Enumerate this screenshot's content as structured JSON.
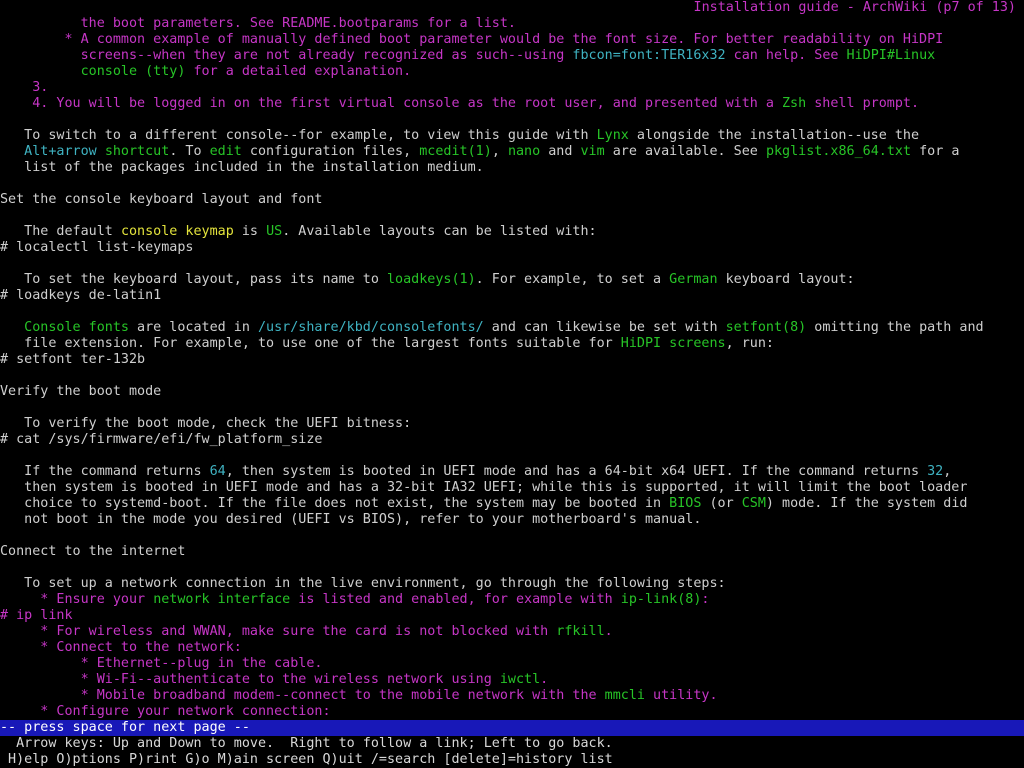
{
  "header": {
    "left": "#",
    "title": "Installation guide - ArchWiki (p7 of 13)"
  },
  "lines": [
    [
      [
        "m",
        "          the boot parameters. See README.bootparams for a list."
      ]
    ],
    [
      [
        "m",
        "        * A common example of manually defined boot parameter would be the font size. For better readability on HiDPI"
      ]
    ],
    [
      [
        "m",
        "          screens--when they are not already recognized as such--using "
      ],
      [
        "c",
        "fbcon=font:TER16x32"
      ],
      [
        "m",
        " can help. See "
      ],
      [
        "g",
        "HiDPI#Linux"
      ]
    ],
    [
      [
        "g",
        "          console (tty)"
      ],
      [
        "m",
        " for a detailed explanation."
      ]
    ],
    [
      [
        "m",
        "    3."
      ]
    ],
    [
      [
        "m",
        "    4. You will be logged in on the first virtual console as the root user, and presented with a "
      ],
      [
        "g",
        "Zsh"
      ],
      [
        "m",
        " shell prompt."
      ]
    ],
    [
      [
        "w",
        ""
      ]
    ],
    [
      [
        "w",
        "   To switch to a different console--for example, to view this guide with "
      ],
      [
        "g",
        "Lynx"
      ],
      [
        "w",
        " alongside the installation--use the"
      ]
    ],
    [
      [
        "c",
        "   Alt+arrow"
      ],
      [
        "w",
        " "
      ],
      [
        "g",
        "shortcut"
      ],
      [
        "w",
        ". To "
      ],
      [
        "g",
        "edit"
      ],
      [
        "w",
        " configuration files, "
      ],
      [
        "g",
        "mcedit(1)"
      ],
      [
        "w",
        ", "
      ],
      [
        "g",
        "nano"
      ],
      [
        "w",
        " and "
      ],
      [
        "g",
        "vim"
      ],
      [
        "w",
        " are available. See "
      ],
      [
        "g",
        "pkglist.x86_64.txt"
      ],
      [
        "w",
        " for a"
      ]
    ],
    [
      [
        "w",
        "   list of the packages included in the installation medium."
      ]
    ],
    [
      [
        "w",
        ""
      ]
    ],
    [
      [
        "w",
        "Set the console keyboard layout and font"
      ]
    ],
    [
      [
        "w",
        ""
      ]
    ],
    [
      [
        "w",
        "   The default "
      ],
      [
        "y",
        "console keymap"
      ],
      [
        "w",
        " is "
      ],
      [
        "g",
        "US"
      ],
      [
        "w",
        ". Available layouts can be listed with:"
      ]
    ],
    [
      [
        "w",
        "# localectl list-keymaps"
      ]
    ],
    [
      [
        "w",
        ""
      ]
    ],
    [
      [
        "w",
        "   To set the keyboard layout, pass its name to "
      ],
      [
        "g",
        "loadkeys(1)"
      ],
      [
        "w",
        ". For example, to set a "
      ],
      [
        "g",
        "German"
      ],
      [
        "w",
        " keyboard layout:"
      ]
    ],
    [
      [
        "w",
        "# loadkeys de-latin1"
      ]
    ],
    [
      [
        "w",
        ""
      ]
    ],
    [
      [
        "g",
        "   Console fonts"
      ],
      [
        "w",
        " are located in "
      ],
      [
        "c",
        "/usr/share/kbd/consolefonts/"
      ],
      [
        "w",
        " and can likewise be set with "
      ],
      [
        "g",
        "setfont(8)"
      ],
      [
        "w",
        " omitting the path and"
      ]
    ],
    [
      [
        "w",
        "   file extension. For example, to use one of the largest fonts suitable for "
      ],
      [
        "g",
        "HiDPI screens"
      ],
      [
        "w",
        ", run:"
      ]
    ],
    [
      [
        "w",
        "# setfont ter-132b"
      ]
    ],
    [
      [
        "w",
        ""
      ]
    ],
    [
      [
        "w",
        "Verify the boot mode"
      ]
    ],
    [
      [
        "w",
        ""
      ]
    ],
    [
      [
        "w",
        "   To verify the boot mode, check the UEFI bitness:"
      ]
    ],
    [
      [
        "w",
        "# cat /sys/firmware/efi/fw_platform_size"
      ]
    ],
    [
      [
        "w",
        ""
      ]
    ],
    [
      [
        "w",
        "   If the command returns "
      ],
      [
        "c",
        "64"
      ],
      [
        "w",
        ", then system is booted in UEFI mode and has a 64-bit x64 UEFI. If the command returns "
      ],
      [
        "c",
        "32"
      ],
      [
        "w",
        ","
      ]
    ],
    [
      [
        "w",
        "   then system is booted in UEFI mode and has a 32-bit IA32 UEFI; while this is supported, it will limit the boot loader"
      ]
    ],
    [
      [
        "w",
        "   choice to systemd-boot. If the file does not exist, the system may be booted in "
      ],
      [
        "g",
        "BIOS"
      ],
      [
        "w",
        " (or "
      ],
      [
        "g",
        "CSM"
      ],
      [
        "w",
        ") mode. If the system did"
      ]
    ],
    [
      [
        "w",
        "   not boot in the mode you desired (UEFI vs BIOS), refer to your motherboard's manual."
      ]
    ],
    [
      [
        "w",
        ""
      ]
    ],
    [
      [
        "w",
        "Connect to the internet"
      ]
    ],
    [
      [
        "w",
        ""
      ]
    ],
    [
      [
        "w",
        "   To set up a network connection in the live environment, go through the following steps:"
      ]
    ],
    [
      [
        "m",
        "     * Ensure your "
      ],
      [
        "g",
        "network interface"
      ],
      [
        "m",
        " is listed and enabled, for example with "
      ],
      [
        "g",
        "ip-link(8)"
      ],
      [
        "m",
        ":"
      ]
    ],
    [
      [
        "m",
        "# ip link"
      ]
    ],
    [
      [
        "m",
        "     * For wireless and WWAN, make sure the card is not blocked with "
      ],
      [
        "g",
        "rfkill"
      ],
      [
        "m",
        "."
      ]
    ],
    [
      [
        "m",
        "     * Connect to the network:"
      ]
    ],
    [
      [
        "m",
        "          * Ethernet--plug in the cable."
      ]
    ],
    [
      [
        "m",
        "          * Wi-Fi--authenticate to the wireless network using "
      ],
      [
        "g",
        "iwctl"
      ],
      [
        "m",
        "."
      ]
    ],
    [
      [
        "m",
        "          * Mobile broadband modem--connect to the mobile network with the "
      ],
      [
        "g",
        "mmcli"
      ],
      [
        "m",
        " utility."
      ]
    ],
    [
      [
        "m",
        "     * Configure your network connection:"
      ]
    ]
  ],
  "status_bar": {
    "text": "-- press space for next page --"
  },
  "help": {
    "line1": "  Arrow keys: Up and Down to move.  Right to follow a link; Left to go back.",
    "line2": " H)elp O)ptions P)rint G)o M)ain screen Q)uit /=search [delete]=history list"
  },
  "colors": {
    "background": "#000000",
    "white": "#cfcfcf",
    "magenta": "#c636c6",
    "green": "#27c427",
    "cyan": "#3fb3c2",
    "yellow": "#e3e33c",
    "status_bg": "#1818b8"
  }
}
